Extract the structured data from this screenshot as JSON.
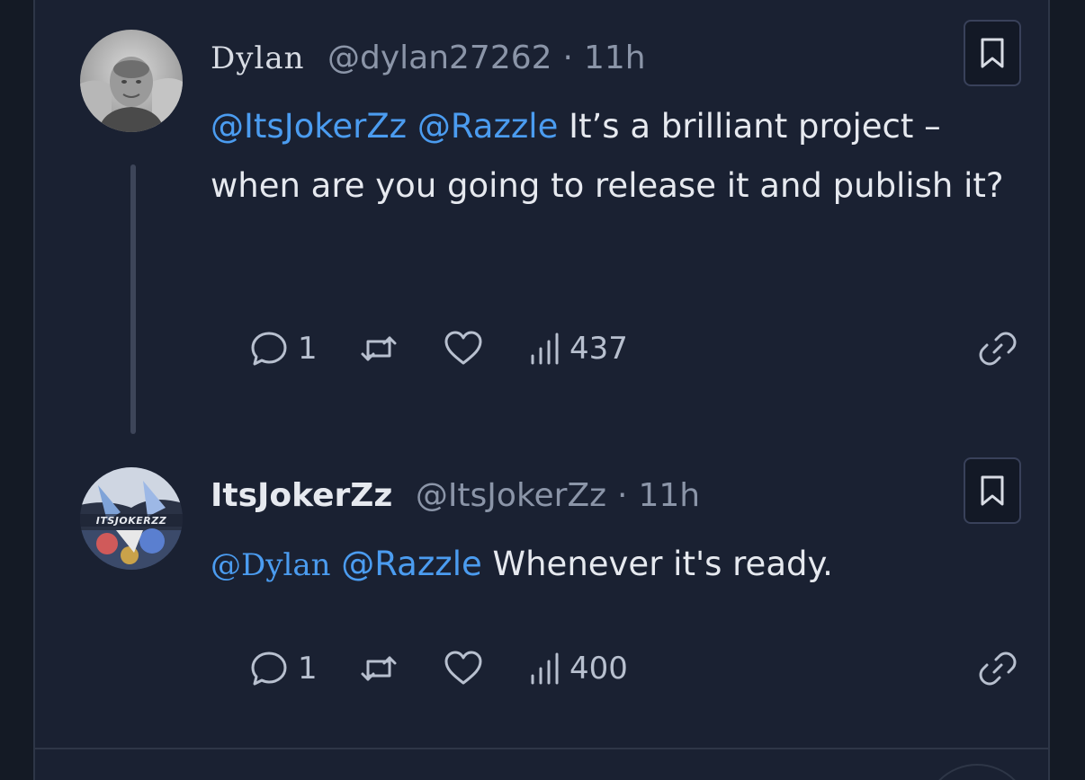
{
  "replies": [
    {
      "display_name": "Dylan",
      "handle": "@dylan27262",
      "separator": "·",
      "time": "11h",
      "mention_1": "@ItsJokerZz",
      "mention_2": "@Razzle",
      "text": "It’s a brilliant project – when are you going to release it and publish it?",
      "reply_count": "1",
      "view_count": "437"
    },
    {
      "display_name": "ItsJokerZz",
      "handle": "@ItsJokerZz",
      "separator": "·",
      "time": "11h",
      "mention_1": "@Dylan",
      "mention_2": "@Razzle",
      "text": "Whenever it's ready.",
      "reply_count": "1",
      "view_count": "400",
      "avatar_text": "ITSJOKERZZ"
    }
  ],
  "icons": {
    "reply": "comment-icon",
    "repost": "repost-icon",
    "like": "heart-icon",
    "views": "bar-chart-icon",
    "share": "link-icon",
    "bookmark": "bookmark-icon"
  },
  "colors": {
    "background": "#141a25",
    "panel": "#1a2132",
    "mention": "#4b9cf0",
    "text": "#e6e9ef",
    "muted": "#8b95a8"
  }
}
